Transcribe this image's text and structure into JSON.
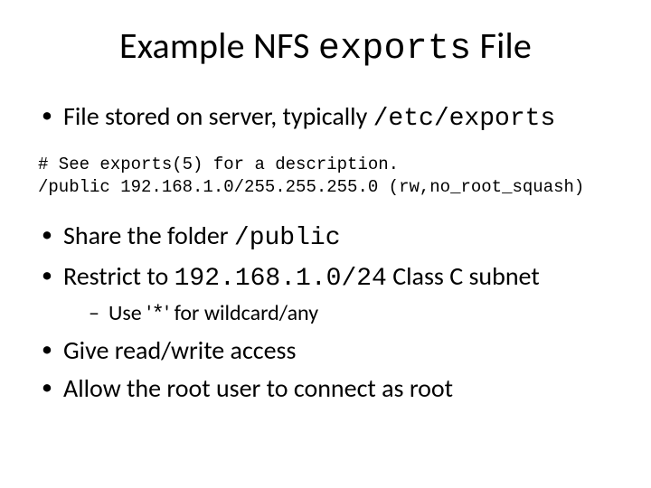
{
  "title": {
    "pre": "Example NFS ",
    "code": "exports",
    "post": " File"
  },
  "bullets": {
    "b1": {
      "pre": "File stored on server, typically ",
      "code": "/etc/exports"
    },
    "b2": {
      "pre": "Share the folder ",
      "code": "/public"
    },
    "b3": {
      "pre": "Restrict to ",
      "code": "192.168.1.0/24",
      "post": " Class C subnet"
    },
    "b3sub": {
      "pre": "Use '",
      "code": "*",
      "post": "' for wildcard/any"
    },
    "b4": "Give read/write access",
    "b5": "Allow the root user to connect as root"
  },
  "code": {
    "line1": "# See exports(5) for a description.",
    "line2": "/public 192.168.1.0/255.255.255.0 (rw,no_root_squash)"
  }
}
